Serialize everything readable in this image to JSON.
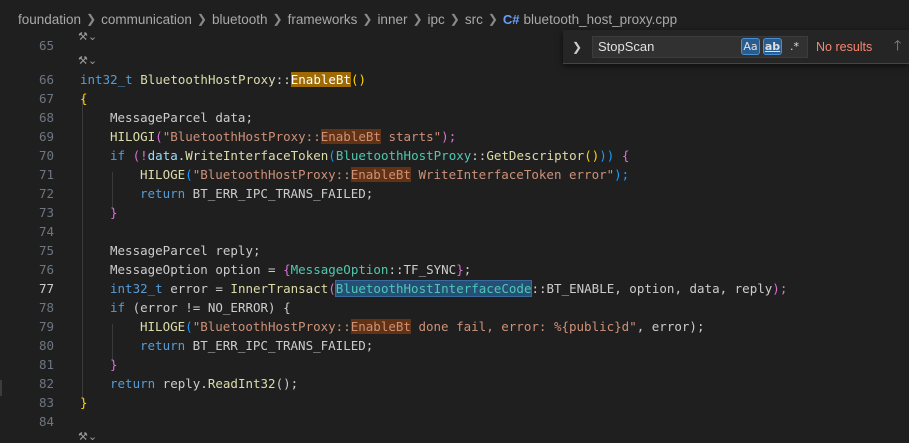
{
  "breadcrumb": [
    "foundation",
    "communication",
    "bluetooth",
    "frameworks",
    "inner",
    "ipc",
    "src",
    "bluetooth_host_proxy.cpp"
  ],
  "file_icon": "C#",
  "find": {
    "query": "StopScan",
    "match_case": "Aa",
    "whole_word": "ab",
    "regex": ".*",
    "result": "No results",
    "toggle_icon": "chevron-right-icon",
    "prev_icon": "arrow-up-icon"
  },
  "lens_icon": "tool-icon",
  "lines": [
    "65",
    "66",
    "67",
    "68",
    "69",
    "70",
    "71",
    "72",
    "73",
    "74",
    "75",
    "76",
    "77",
    "78",
    "79",
    "80",
    "81",
    "82",
    "83",
    "84"
  ],
  "current_line": "77",
  "code": {
    "l66": [
      "int32_t",
      " BluetoothHostProxy",
      "::",
      "EnableBt",
      "()"
    ],
    "l68": "MessageParcel data;",
    "l69": [
      "HILOGI",
      "(",
      "\"BluetoothHostProxy::",
      "EnableBt",
      " starts\"",
      ");"
    ],
    "l70": [
      "if",
      " (!",
      "data",
      ".",
      "WriteInterfaceToken",
      "(",
      "BluetoothHostProxy",
      "::",
      "GetDescriptor",
      "()",
      "))",
      " {"
    ],
    "l71": [
      "HILOGE",
      "(",
      "\"BluetoothHostProxy::",
      "EnableBt",
      " WriteInterfaceToken error\"",
      ");"
    ],
    "l72": [
      "return",
      " BT_ERR_IPC_TRANS_FAILED;"
    ],
    "l75": "MessageParcel reply;",
    "l76": [
      "MessageOption option = ",
      "{",
      "MessageOption",
      "::",
      "TF_SYNC",
      "}",
      ";"
    ],
    "l77": [
      "int32_t",
      " error = ",
      "InnerTransact",
      "(",
      "BluetoothHostInterfaceCode",
      "::BT_ENABLE, option, data, reply",
      ");"
    ],
    "l78": [
      "if",
      " (error != NO_ERROR) {"
    ],
    "l79": [
      "HILOGE",
      "(",
      "\"BluetoothHostProxy::",
      "EnableBt",
      " done fail, error: %{public}d\"",
      ", error);"
    ],
    "l80": [
      "return",
      " BT_ERR_IPC_TRANS_FAILED;"
    ],
    "l82": [
      "return",
      " reply.",
      "ReadInt32",
      "();"
    ]
  }
}
